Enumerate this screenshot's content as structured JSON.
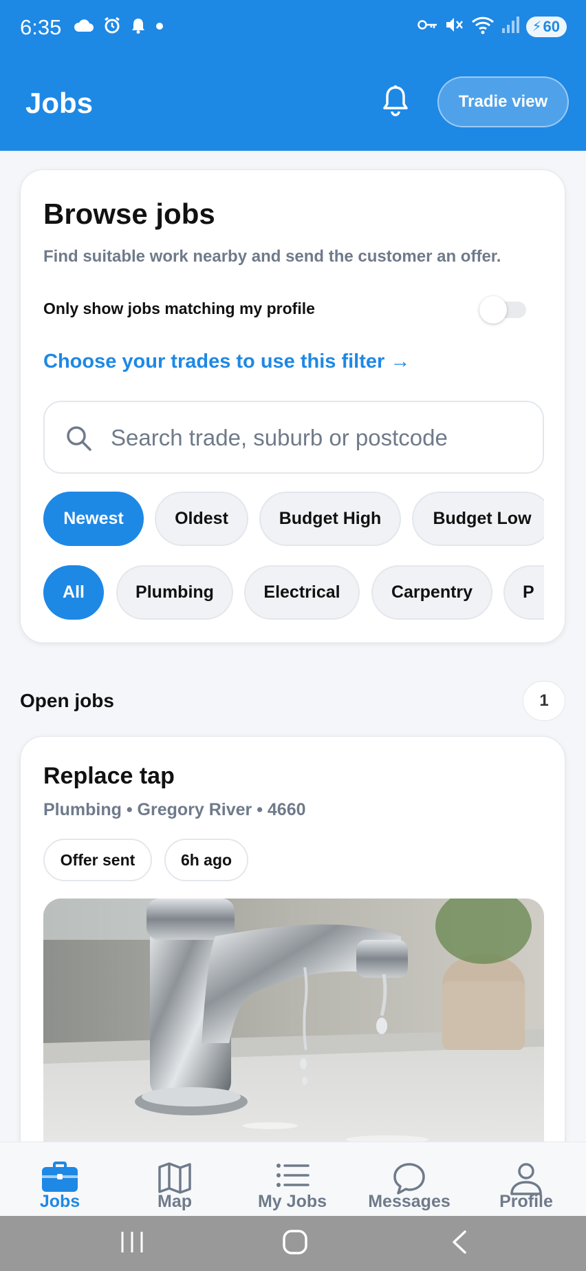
{
  "status_bar": {
    "time": "6:35",
    "battery": "60",
    "icons": [
      "cloud-icon",
      "alarm-icon",
      "notification-bell-icon",
      "dot-icon",
      "key-icon",
      "mute-icon",
      "wifi-icon",
      "signal-icon",
      "battery-icon"
    ]
  },
  "header": {
    "title": "Jobs",
    "tradie_button": "Tradie view",
    "bell_icon": "bell-icon"
  },
  "browse": {
    "title": "Browse jobs",
    "subtitle": "Find suitable work nearby and send the customer an offer.",
    "match_toggle_label": "Only show jobs matching my profile",
    "match_toggle_on": false,
    "trades_link": "Choose your trades to use this filter →",
    "search_placeholder": "Search trade, suburb or postcode",
    "sort_chips": [
      "Newest",
      "Oldest",
      "Budget High",
      "Budget Low"
    ],
    "sort_selected": "Newest",
    "category_chips": [
      "All",
      "Plumbing",
      "Electrical",
      "Carpentry",
      "P"
    ],
    "category_selected": "All"
  },
  "open_jobs": {
    "label": "Open jobs",
    "count": "1"
  },
  "job": {
    "title": "Replace tap",
    "meta": "Plumbing • Gregory River • 4660",
    "status_pill": "Offer sent",
    "age_pill": "6h ago",
    "photo": "dripping-faucet-photo"
  },
  "bottom_nav": [
    {
      "label": "Jobs",
      "icon": "briefcase-icon",
      "active": true
    },
    {
      "label": "Map",
      "icon": "map-icon",
      "active": false
    },
    {
      "label": "My Jobs",
      "icon": "list-icon",
      "active": false
    },
    {
      "label": "Messages",
      "icon": "chat-icon",
      "active": false
    },
    {
      "label": "Profile",
      "icon": "person-icon",
      "active": false
    }
  ],
  "colors": {
    "primary": "#1e88e5",
    "background": "#f4f6f9",
    "muted_text": "#6f7a8a"
  }
}
